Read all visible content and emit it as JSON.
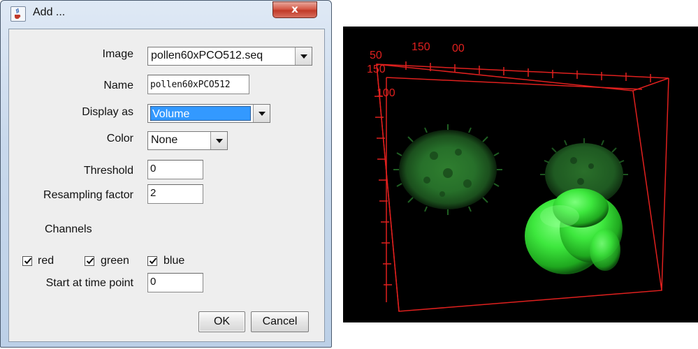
{
  "window": {
    "title": "Add ...",
    "close_symbol": "x",
    "icon": "java-cup-icon"
  },
  "form": {
    "image_label": "Image",
    "image_value": "pollen60xPCO512.seq",
    "name_label": "Name",
    "name_value": "pollen60xPCO512",
    "display_label": "Display as",
    "display_value": "Volume",
    "color_label": "Color",
    "color_value": "None",
    "threshold_label": "Threshold",
    "threshold_value": "0",
    "resampling_label": "Resampling factor",
    "resampling_value": "2",
    "channels_label": "Channels",
    "channels": [
      {
        "label": "red",
        "checked": true
      },
      {
        "label": "green",
        "checked": true
      },
      {
        "label": "blue",
        "checked": true
      }
    ],
    "start_label": "Start at time point",
    "start_value": "0"
  },
  "buttons": {
    "ok": "OK",
    "cancel": "Cancel"
  },
  "viewer": {
    "axis_labels": {
      "a": "50",
      "b": "150",
      "c": "00",
      "d": "150",
      "e": "100"
    },
    "colors": {
      "background": "#000000",
      "bounding_box": "#e0201e",
      "pollen_dim": "#2e8a2e",
      "pollen_bright": "#3ef03e"
    }
  }
}
